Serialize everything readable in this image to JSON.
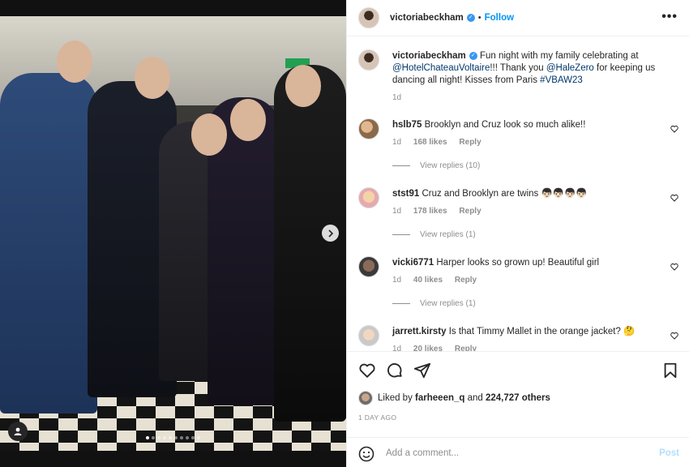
{
  "post": {
    "username": "victoriabeckham",
    "follow_label": "Follow",
    "dot": "•",
    "more_label": "•••",
    "caption_text": "Fun night with my family celebrating at",
    "caption_mention_1": "@HotelChateauVoltaire",
    "caption_mid": "!!! Thank you",
    "caption_mention_2": "@HaleZero",
    "caption_tail": "for keeping us dancing all night! Kisses from Paris",
    "caption_hashtag": "#VBAW23",
    "caption_age": "1d",
    "carousel_count": 10,
    "carousel_active": 0
  },
  "comments": [
    {
      "user": "hslb75",
      "text": "Brooklyn and Cruz look so much alike!!",
      "age": "1d",
      "likes": "168 likes",
      "reply": "Reply",
      "view_replies": "View replies (10)"
    },
    {
      "user": "stst91",
      "text": "Cruz and Brooklyn are twins 👦🏻👦🏻👦🏻👦🏻",
      "age": "1d",
      "likes": "178 likes",
      "reply": "Reply",
      "view_replies": "View replies (1)"
    },
    {
      "user": "vicki6771",
      "text": "Harper looks so grown up! Beautiful girl",
      "age": "1d",
      "likes": "40 likes",
      "reply": "Reply",
      "view_replies": "View replies (1)"
    },
    {
      "user": "jarrett.kirsty",
      "text": "Is that Timmy Mallet in the orange jacket? 🤔",
      "age": "1d",
      "likes": "20 likes",
      "reply": "Reply"
    }
  ],
  "engagement": {
    "liked_by_prefix": "Liked by",
    "liked_by_user": "farheeen_q",
    "liked_by_and": "and",
    "liked_by_others": "224,727 others",
    "timestamp": "1 DAY AGO"
  },
  "composer": {
    "placeholder": "Add a comment...",
    "post_label": "Post"
  },
  "icons": {
    "verified": "verified-badge-icon",
    "heart": "heart-icon",
    "comment": "comment-icon",
    "share": "share-icon",
    "save": "bookmark-icon",
    "emoji": "emoji-icon",
    "next": "chevron-right-icon",
    "user_tag": "user-tag-icon",
    "more": "more-options-icon"
  },
  "colors": {
    "link": "#00376b",
    "accent": "#0095f6",
    "verified": "#3897f0",
    "muted": "#8e8e8e"
  }
}
